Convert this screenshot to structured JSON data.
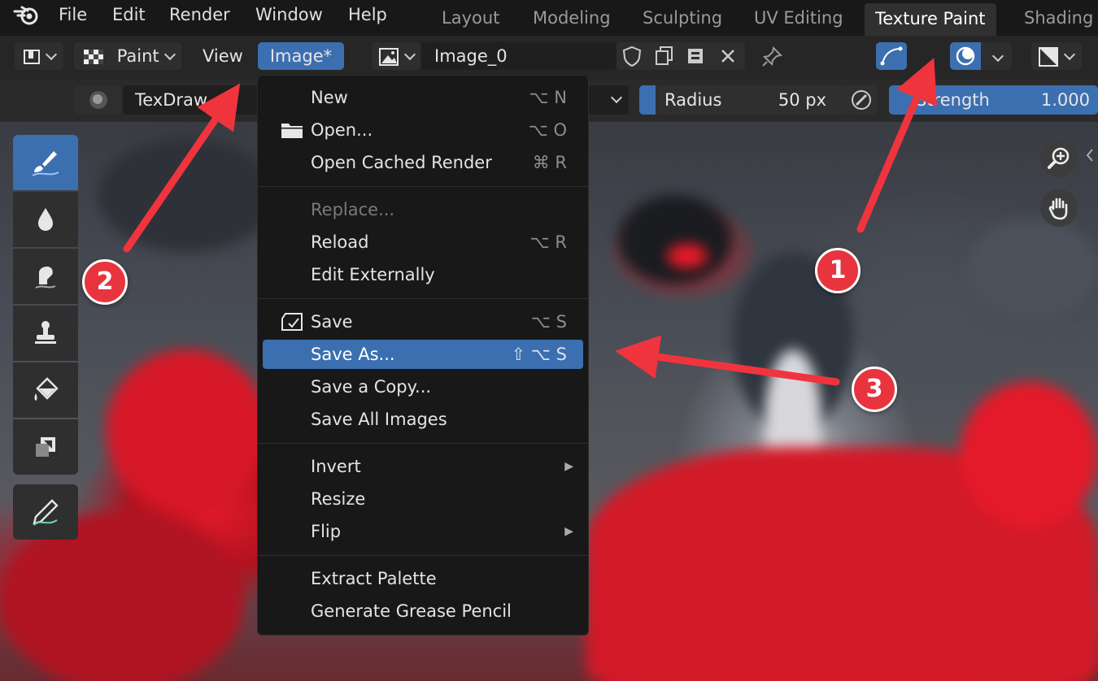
{
  "menubar": {
    "items": [
      "File",
      "Edit",
      "Render",
      "Window",
      "Help"
    ],
    "workspaces": [
      "Layout",
      "Modeling",
      "Sculpting",
      "UV Editing",
      "Texture Paint",
      "Shading"
    ],
    "active_workspace": "Texture Paint"
  },
  "header": {
    "mode": "Paint",
    "view": "View",
    "image_menu": "Image*",
    "image_name": "Image_0"
  },
  "tool_settings": {
    "brush": "TexDraw",
    "radius_label": "Radius",
    "radius_value": "50 px",
    "strength_label": "Strength",
    "strength_value": "1.000"
  },
  "image_menu": {
    "items": [
      {
        "label": "New",
        "shortcut": "⌥ N"
      },
      {
        "label": "Open...",
        "shortcut": "⌥ O",
        "icon": "folder-icon"
      },
      {
        "label": "Open Cached Render",
        "shortcut": "⌘ R"
      },
      {
        "label": "Replace...",
        "shortcut": "",
        "disabled": true
      },
      {
        "label": "Reload",
        "shortcut": "⌥ R"
      },
      {
        "label": "Edit Externally",
        "shortcut": ""
      },
      {
        "label": "Save",
        "shortcut": "⌥ S",
        "icon": "save-icon"
      },
      {
        "label": "Save As...",
        "shortcut": "⇧ ⌥ S",
        "highlighted": true
      },
      {
        "label": "Save a Copy...",
        "shortcut": ""
      },
      {
        "label": "Save All Images",
        "shortcut": ""
      },
      {
        "label": "Invert",
        "shortcut": "",
        "submenu": true
      },
      {
        "label": "Resize",
        "shortcut": ""
      },
      {
        "label": "Flip",
        "shortcut": "",
        "submenu": true
      },
      {
        "label": "Extract Palette",
        "shortcut": ""
      },
      {
        "label": "Generate Grease Pencil",
        "shortcut": ""
      }
    ]
  },
  "annotations": {
    "badge_1": "1",
    "badge_2": "2",
    "badge_3": "3"
  },
  "colors": {
    "accent": "#3c6fb0",
    "annotation": "#e8343e"
  }
}
